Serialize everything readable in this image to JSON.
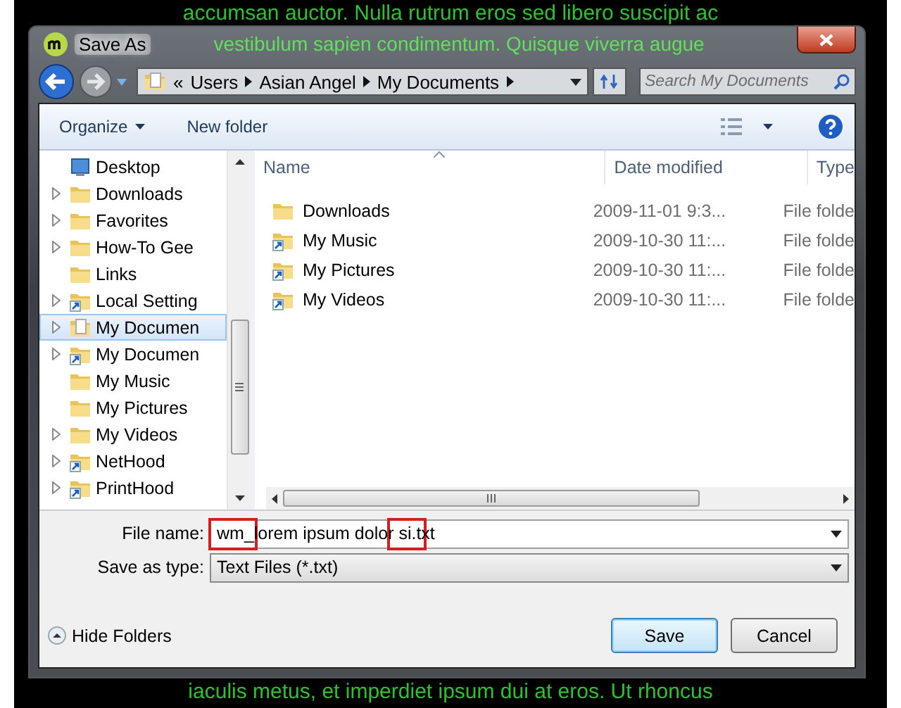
{
  "background_text": [
    "accumsan auctor. Nulla rutrum eros sed libero suscipit ac",
    "vestibulum sapien condimentum. Quisque viverra augue",
    "iaculis metus, et imperdiet ipsum dui at eros. Ut rhoncus"
  ],
  "window": {
    "title": "Save As"
  },
  "address_bar": {
    "overflow": "«",
    "crumbs": [
      "Users",
      "Asian Angel",
      "My Documents"
    ]
  },
  "search": {
    "placeholder": "Search My Documents"
  },
  "toolbar": {
    "organize": "Organize",
    "new_folder": "New folder"
  },
  "sidebar": {
    "items": [
      {
        "label": "Desktop",
        "kind": "desktop",
        "expandable": false,
        "selected": false
      },
      {
        "label": "Downloads",
        "kind": "folder",
        "expandable": true,
        "selected": false
      },
      {
        "label": "Favorites",
        "kind": "folder",
        "expandable": true,
        "selected": false
      },
      {
        "label": "How-To Gee",
        "kind": "folder",
        "expandable": true,
        "selected": false
      },
      {
        "label": "Links",
        "kind": "folder",
        "expandable": false,
        "selected": false
      },
      {
        "label": "Local Setting",
        "kind": "shortcut",
        "expandable": true,
        "selected": false
      },
      {
        "label": "My Documen",
        "kind": "document",
        "expandable": true,
        "selected": true
      },
      {
        "label": "My Documen",
        "kind": "shortcut",
        "expandable": true,
        "selected": false
      },
      {
        "label": "My Music",
        "kind": "folder",
        "expandable": false,
        "selected": false
      },
      {
        "label": "My Pictures",
        "kind": "folder",
        "expandable": false,
        "selected": false
      },
      {
        "label": "My Videos",
        "kind": "folder",
        "expandable": true,
        "selected": false
      },
      {
        "label": "NetHood",
        "kind": "shortcut",
        "expandable": true,
        "selected": false
      },
      {
        "label": "PrintHood",
        "kind": "shortcut",
        "expandable": true,
        "selected": false
      }
    ]
  },
  "table": {
    "columns": [
      "Name",
      "Date modified",
      "Type"
    ],
    "rows": [
      {
        "kind": "folder",
        "name": "Downloads",
        "date": "2009-11-01 9:3...",
        "type": "File folde"
      },
      {
        "kind": "shortcut",
        "name": "My Music",
        "date": "2009-10-30 11:...",
        "type": "File folde"
      },
      {
        "kind": "shortcut",
        "name": "My Pictures",
        "date": "2009-10-30 11:...",
        "type": "File folde"
      },
      {
        "kind": "shortcut",
        "name": "My Videos",
        "date": "2009-10-30 11:...",
        "type": "File folde"
      }
    ]
  },
  "file_name": {
    "label": "File name:",
    "value": "wm_lorem ipsum dolor si.txt"
  },
  "save_as_type": {
    "label": "Save as type:",
    "value": "Text Files (*.txt)"
  },
  "hide_folders": "Hide Folders",
  "buttons": [
    {
      "label": "Save",
      "default": true
    },
    {
      "label": "Cancel",
      "default": false
    }
  ]
}
